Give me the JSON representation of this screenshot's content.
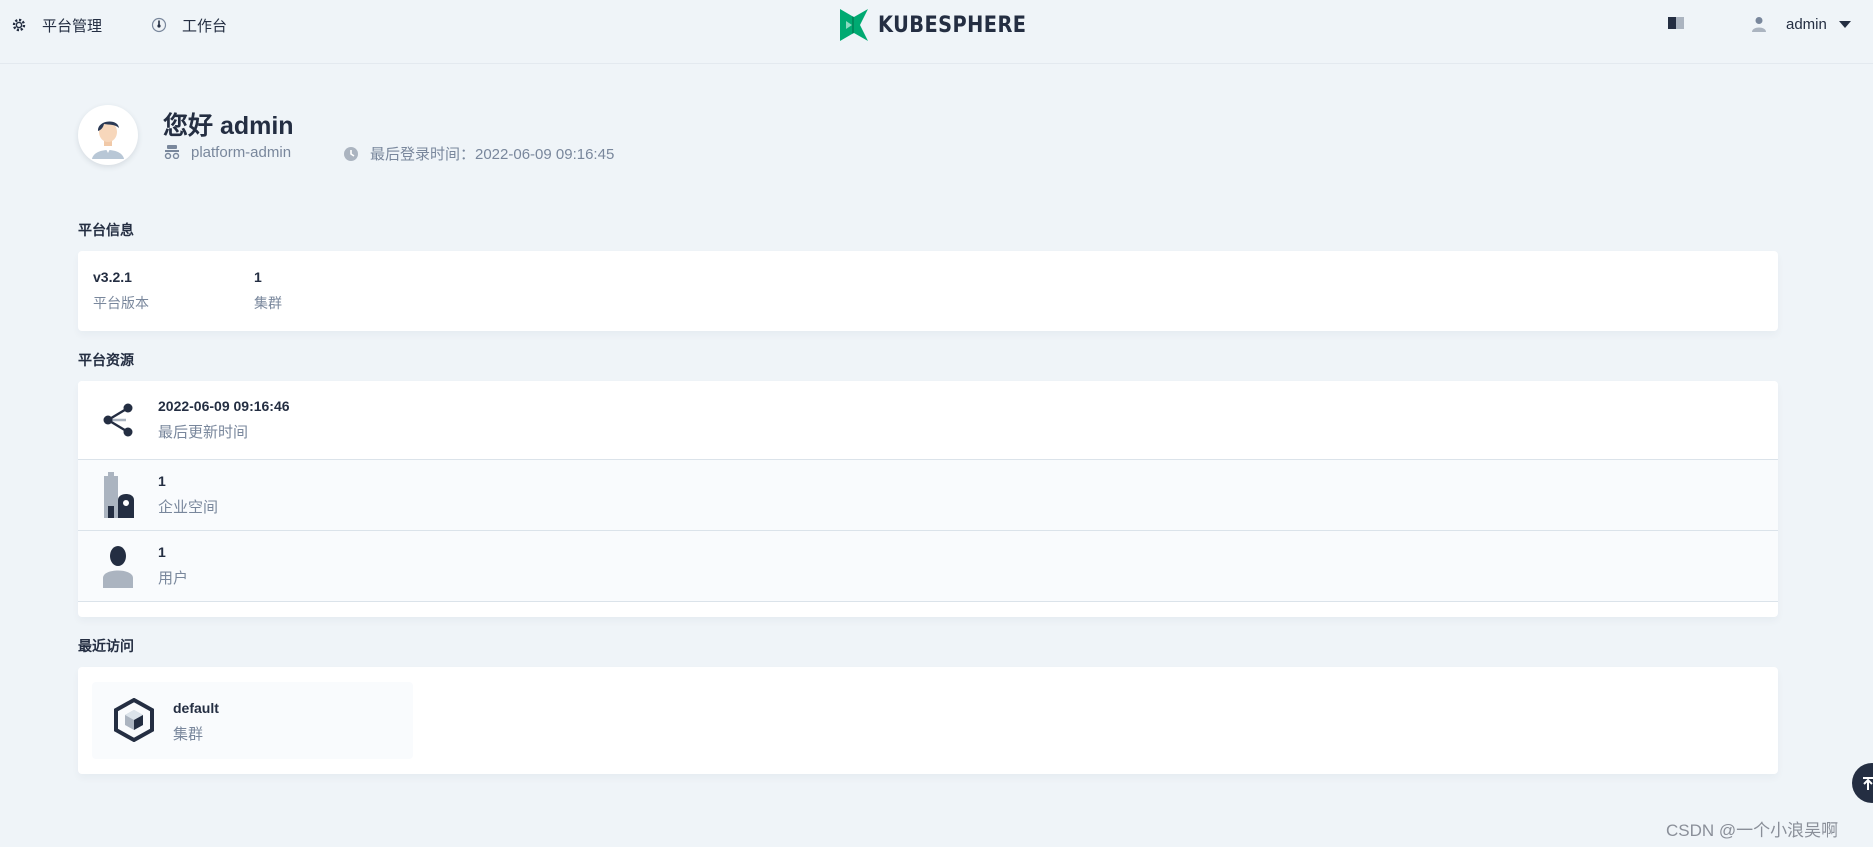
{
  "nav": {
    "platform_label": "平台管理",
    "workbench_label": "工作台",
    "logo_text": "KUBESPHERE",
    "user_name": "admin"
  },
  "greeting": {
    "title": "您好 admin",
    "role": "platform-admin",
    "last_login": "最后登录时间：2022-06-09 09:16:45"
  },
  "platform_info": {
    "title": "平台信息",
    "version_value": "v3.2.1",
    "version_label": "平台版本",
    "clusters_value": "1",
    "clusters_label": "集群"
  },
  "platform_resources": {
    "title": "平台资源",
    "items": [
      {
        "value": "2022-06-09 09:16:46",
        "label": "最后更新时间",
        "icon": "share-icon"
      },
      {
        "value": "1",
        "label": "企业空间",
        "icon": "enterprise-space-icon"
      },
      {
        "value": "1",
        "label": "用户",
        "icon": "user-icon"
      }
    ]
  },
  "recent": {
    "title": "最近访问",
    "items": [
      {
        "name": "default",
        "type": "集群",
        "icon": "cluster-icon"
      }
    ]
  },
  "watermark": "CSDN @一个小浪吴啊",
  "colors": {
    "background": "#eff4f8",
    "text_primary": "#242e42",
    "text_secondary": "#79879c",
    "brand_green": "#00aa72"
  }
}
